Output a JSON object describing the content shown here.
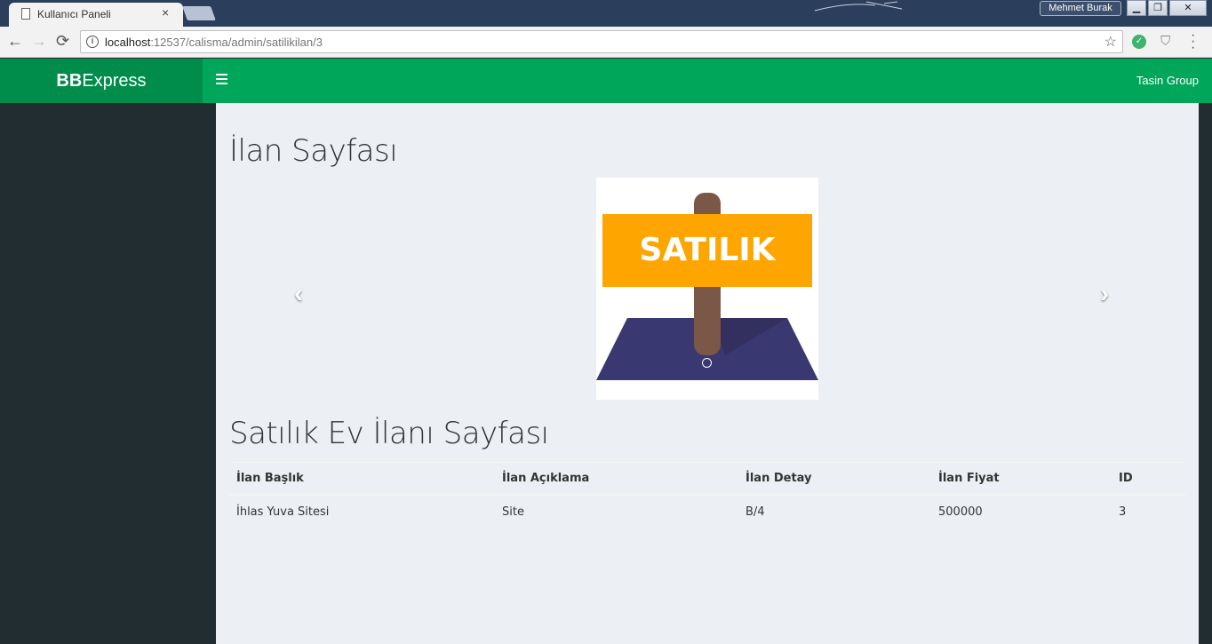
{
  "browser": {
    "tab_title": "Kullanıcı Paneli",
    "tab_close": "×",
    "user_badge": "Mehmet Burak",
    "minimize": "▁",
    "restore": "❐",
    "close": "✕",
    "url_host": "localhost",
    "url_rest": ":12537/calisma/admin/satilikilan/3",
    "back": "←",
    "forward": "→",
    "reload": "⟳",
    "info": "i",
    "star": "☆",
    "shield": "⛉"
  },
  "header": {
    "logo_bold": "BB",
    "logo_rest": "Express",
    "user_menu": "Tasin Group"
  },
  "main": {
    "title": "İlan Sayfası",
    "subtitle": "Satılık Ev İlanı Sayfası",
    "carousel": {
      "image_text": "SATILIK",
      "prev": "‹",
      "next": "›"
    },
    "table": {
      "headers": [
        "İlan Başlık",
        "İlan Açıklama",
        "İlan Detay",
        "İlan Fiyat",
        "ID"
      ],
      "rows": [
        [
          "İhlas Yuva Sitesi",
          "Site",
          "B/4",
          "500000",
          "3"
        ]
      ]
    }
  },
  "colors": {
    "header_green": "#00a65a",
    "logo_green": "#008d4c",
    "sidebar": "#222d32",
    "content_bg": "#ecf0f5",
    "sign_orange": "#ffa500",
    "sign_post": "#7b5747",
    "ground": "#3a3870"
  }
}
